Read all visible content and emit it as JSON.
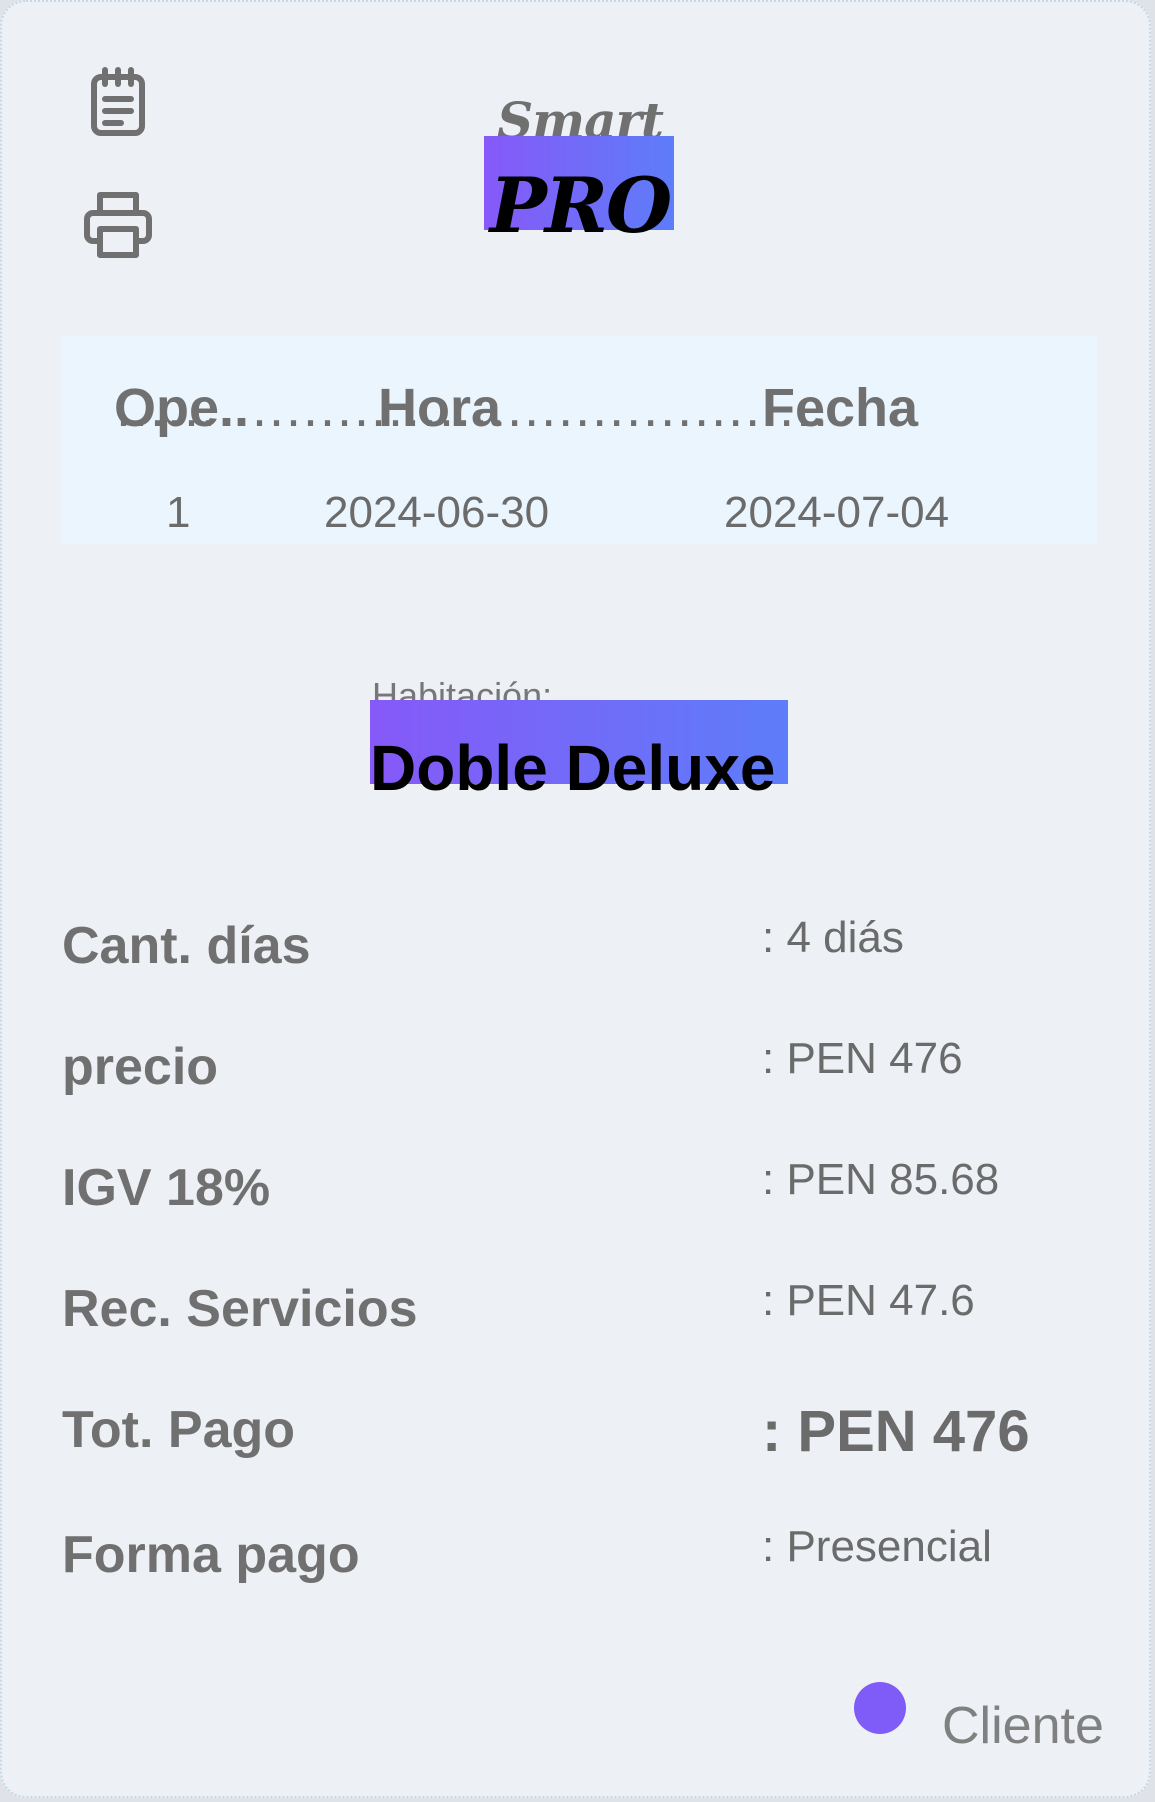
{
  "toolbar": {
    "notes_icon": "notepad-icon",
    "print_icon": "printer-icon"
  },
  "logo": {
    "top_text": "Smart",
    "bottom_text": "PRO",
    "gradient_colors": [
      "#8659f8",
      "#5d7df9"
    ]
  },
  "operations": {
    "headers": [
      "Ope..",
      "Hora",
      "Fecha"
    ],
    "header_dots": "..........................................",
    "row": {
      "operation": "1",
      "hora": "2024-06-30",
      "fecha": "2024-07-04"
    }
  },
  "room": {
    "label": "Habitación:",
    "name": "Doble Deluxe"
  },
  "details": [
    {
      "label": "Cant. días",
      "value": ": 4 diás"
    },
    {
      "label": "precio",
      "value": ": PEN 476"
    },
    {
      "label": "IGV 18%",
      "value": ": PEN 85.68"
    },
    {
      "label": "Rec. Servicios",
      "value": ": PEN 47.6"
    },
    {
      "label": "Tot. Pago",
      "value": ": PEN 476"
    },
    {
      "label": "Forma pago",
      "value": ": Presencial"
    }
  ],
  "client": {
    "label": "Cliente",
    "indicator_color": "#7f5bf7"
  }
}
